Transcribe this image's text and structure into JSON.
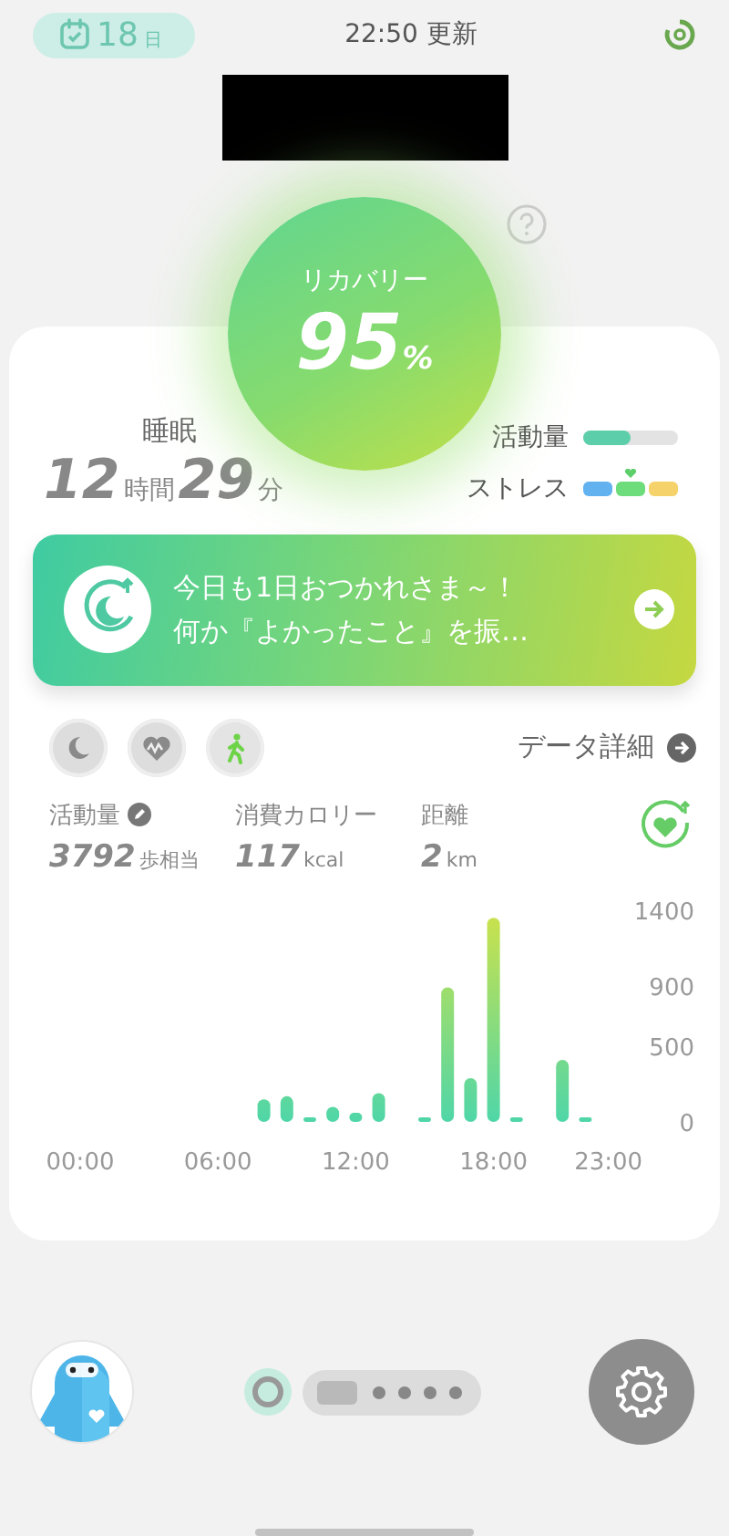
{
  "header": {
    "date_day": "18",
    "date_unit": "日",
    "updated": "22:50 更新"
  },
  "recovery": {
    "label": "リカバリー",
    "value": "95",
    "unit": "%"
  },
  "sleep": {
    "label": "睡眠",
    "hours": "12",
    "hours_unit": "時間",
    "minutes": "29",
    "minutes_unit": "分"
  },
  "activity_meter": {
    "label": "活動量",
    "level": 0.5
  },
  "stress_meter": {
    "label": "ストレス",
    "level": 0.5
  },
  "banner": {
    "line1": "今日も1日おつかれさま～！",
    "line2": "何か『よかったこと』を振…"
  },
  "category_tabs": [
    {
      "kind": "sleep",
      "selected": false
    },
    {
      "kind": "heart",
      "selected": false
    },
    {
      "kind": "walk",
      "selected": true
    }
  ],
  "details_link": "データ詳細",
  "stats": [
    {
      "label": "活動量",
      "value": "3792",
      "unit": "歩相当",
      "editable": true
    },
    {
      "label": "消費カロリー",
      "value": "117",
      "unit": "kcal",
      "editable": false
    },
    {
      "label": "距離",
      "value": "2",
      "unit": "km",
      "editable": false
    }
  ],
  "chart_data": {
    "type": "bar",
    "x": [
      8,
      9,
      10,
      11,
      12,
      13,
      15,
      16,
      17,
      18,
      19,
      21,
      22
    ],
    "values": [
      150,
      170,
      30,
      100,
      60,
      190,
      30,
      890,
      290,
      1350,
      30,
      410,
      30
    ],
    "xticks": [
      {
        "value": 0,
        "label": "00:00"
      },
      {
        "value": 6,
        "label": "06:00"
      },
      {
        "value": 12,
        "label": "12:00"
      },
      {
        "value": 18,
        "label": "18:00"
      },
      {
        "value": 23,
        "label": "23:00"
      }
    ],
    "yticks": [
      0,
      500,
      900,
      1400
    ],
    "xlim": [
      0,
      23
    ],
    "ylim": [
      0,
      1400
    ]
  }
}
